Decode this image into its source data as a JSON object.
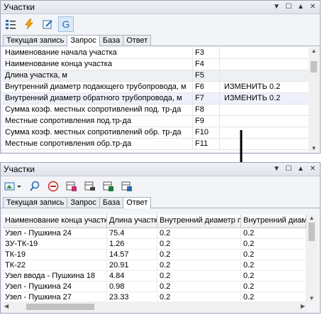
{
  "top_panel": {
    "title": "Участки",
    "tabs": [
      "Текущая запись",
      "Запрос",
      "База",
      "Ответ"
    ],
    "active_tab": "Запрос",
    "rows": [
      {
        "name": "Наименование начала участка",
        "field": "F3",
        "value": ""
      },
      {
        "name": "Наименование конца участка",
        "field": "F4",
        "value": ""
      },
      {
        "name": "Длина участка, м",
        "field": "F5",
        "value": ""
      },
      {
        "name": "Внутренний диаметр подающего трубопровода, м",
        "field": "F6",
        "value": "ИЗМЕНИТЬ 0.2"
      },
      {
        "name": "Внутренний диаметр обратного трубопровода, м",
        "field": "F7",
        "value": "ИЗМЕНИТЬ 0.2"
      },
      {
        "name": "Сумма коэф. местных сопротивлений под. тр-да",
        "field": "F8",
        "value": ""
      },
      {
        "name": "Местные сопротивления под.тр-да",
        "field": "F9",
        "value": ""
      },
      {
        "name": "Сумма коэф. местных сопротивлений обр. тр-да",
        "field": "F10",
        "value": ""
      },
      {
        "name": "Местные сопротивления обр.тр-да",
        "field": "F11",
        "value": ""
      }
    ]
  },
  "bottom_panel": {
    "title": "Участки",
    "tabs": [
      "Текущая запись",
      "Запрос",
      "База",
      "Ответ"
    ],
    "active_tab": "Ответ",
    "columns": [
      "Наименование конца участка",
      "Длина участка, м",
      "Внутренний диаметр подающего",
      "Внутренний диаметр"
    ],
    "rows": [
      [
        "Узел - Пушкина 24",
        "75.4",
        "0.2",
        "0.2"
      ],
      [
        "ЗУ-ТК-19",
        "1.26",
        "0.2",
        "0.2"
      ],
      [
        "ТК-19",
        "14.57",
        "0.2",
        "0.2"
      ],
      [
        "ТК-22",
        "20.91",
        "0.2",
        "0.2"
      ],
      [
        "Узел ввода -  Пушкина 18",
        "4.84",
        "0.2",
        "0.2"
      ],
      [
        "Узел - Пушкина 24",
        "0.98",
        "0.2",
        "0.2"
      ],
      [
        "Узел - Пушкина 27",
        "23.33",
        "0.2",
        "0.2"
      ]
    ]
  }
}
